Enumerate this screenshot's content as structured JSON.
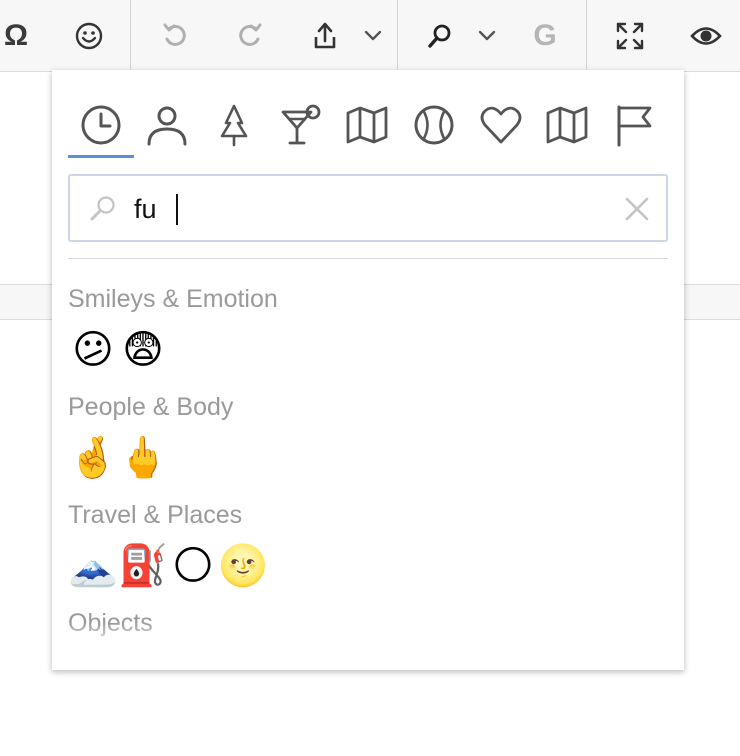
{
  "toolbar": {
    "items": [
      {
        "name": "special-character-icon",
        "glyph": "Ω"
      },
      {
        "name": "emoji-icon"
      },
      {
        "name": "undo-icon"
      },
      {
        "name": "redo-icon"
      },
      {
        "name": "upload-icon"
      },
      {
        "name": "chevron-down-icon"
      },
      {
        "name": "find-icon"
      },
      {
        "name": "chevron-down-icon"
      },
      {
        "name": "grammar-icon",
        "glyph": "G"
      },
      {
        "name": "fullscreen-icon"
      },
      {
        "name": "preview-icon"
      }
    ]
  },
  "emoji_picker": {
    "categories": [
      {
        "name": "recent",
        "icon": "clock-icon",
        "active": true
      },
      {
        "name": "people",
        "icon": "person-icon"
      },
      {
        "name": "nature",
        "icon": "tree-icon"
      },
      {
        "name": "food",
        "icon": "cocktail-icon"
      },
      {
        "name": "travel",
        "icon": "map-icon"
      },
      {
        "name": "activity",
        "icon": "ball-icon"
      },
      {
        "name": "symbols",
        "icon": "heart-icon"
      },
      {
        "name": "objects",
        "icon": "map-icon"
      },
      {
        "name": "flags",
        "icon": "flag-icon"
      }
    ],
    "search": {
      "value": "fu",
      "placeholder": ""
    },
    "sections": [
      {
        "title": "Smileys & Emotion",
        "emojis": [
          "😕",
          "😨"
        ]
      },
      {
        "title": "People & Body",
        "emojis": [
          "🤞",
          "🖕"
        ]
      },
      {
        "title": "Travel & Places",
        "emojis": [
          "🗻",
          "⛽",
          "🌕",
          "🌝"
        ]
      },
      {
        "title": "Objects",
        "emojis": []
      }
    ],
    "colors": {
      "accent": "#5b8fd9",
      "section_title": "#9a9a9a",
      "icon": "#555555"
    }
  }
}
